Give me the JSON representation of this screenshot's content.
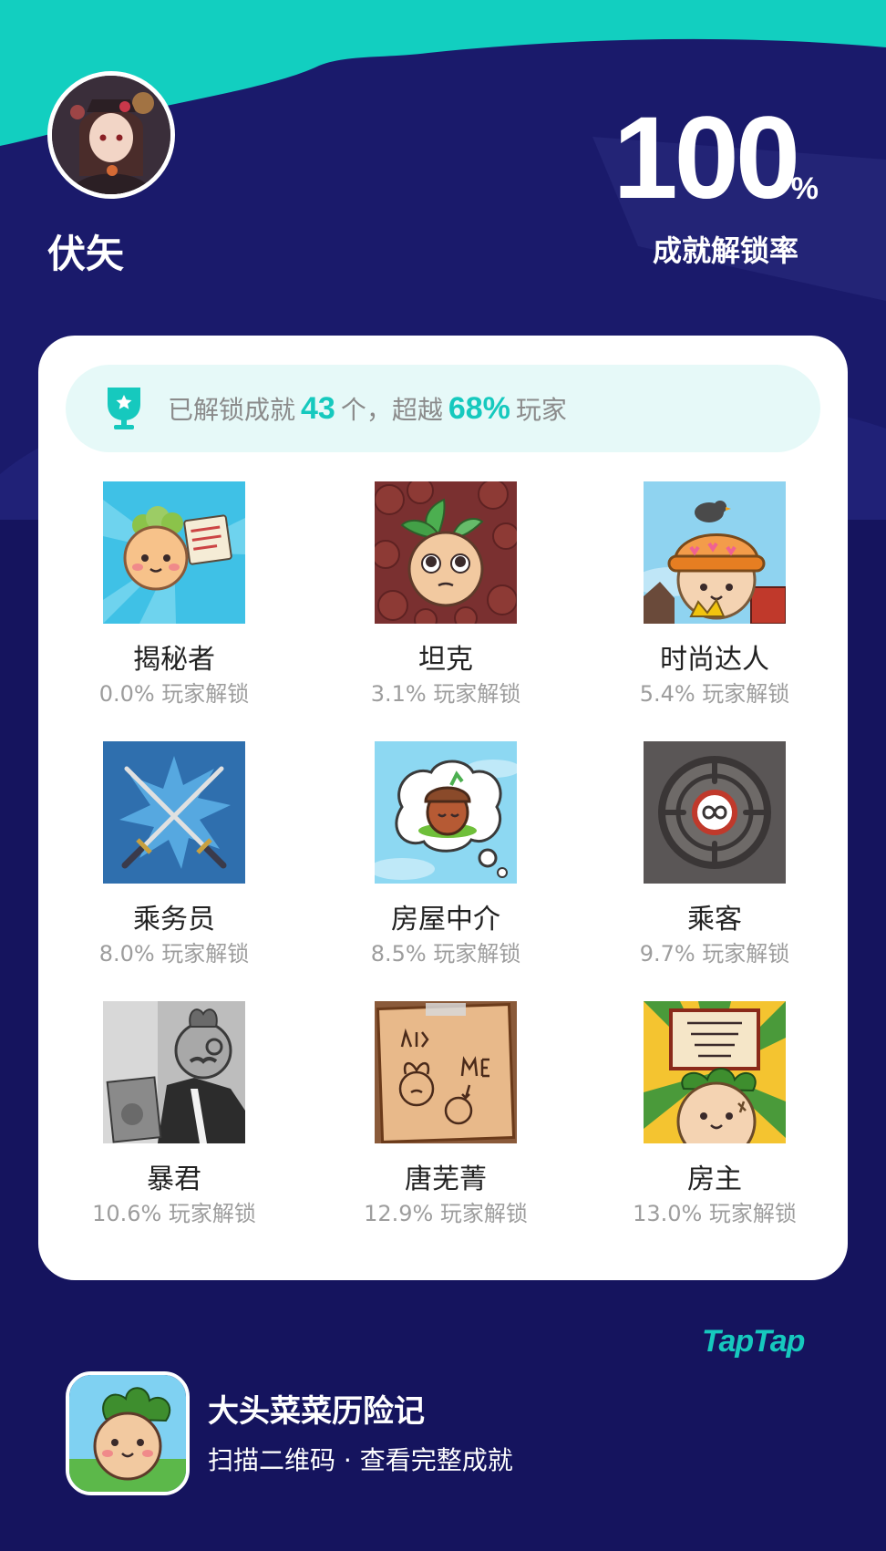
{
  "profile": {
    "username": "伏矢"
  },
  "completion": {
    "rate": "100",
    "percent_sign": "%",
    "label": "成就解锁率"
  },
  "summary": {
    "prefix": "已解锁成就",
    "count": "43",
    "middle": "个，超越",
    "beat_percent": "68%",
    "suffix": "玩家"
  },
  "achievements": [
    {
      "name": "揭秘者",
      "unlock_rate": "0.0% 玩家解锁",
      "icon": "turnip-with-notes-icon"
    },
    {
      "name": "坦克",
      "unlock_rate": "3.1% 玩家解锁",
      "icon": "teary-turnip-icon"
    },
    {
      "name": "时尚达人",
      "unlock_rate": "5.4% 玩家解锁",
      "icon": "turnip-with-hat-icon"
    },
    {
      "name": "乘务员",
      "unlock_rate": "8.0% 玩家解锁",
      "icon": "crossed-swords-icon"
    },
    {
      "name": "房屋中介",
      "unlock_rate": "8.5% 玩家解锁",
      "icon": "acorn-thought-bubble-icon"
    },
    {
      "name": "乘客",
      "unlock_rate": "9.7% 玩家解锁",
      "icon": "infinity-crosshair-icon"
    },
    {
      "name": "暴君",
      "unlock_rate": "10.6% 玩家解锁",
      "icon": "monocle-turnip-icon"
    },
    {
      "name": "唐芜菁",
      "unlock_rate": "12.9% 玩家解锁",
      "icon": "family-drawing-icon"
    },
    {
      "name": "房主",
      "unlock_rate": "13.0% 玩家解锁",
      "icon": "property-deed-turnip-icon"
    }
  ],
  "footer": {
    "brand": "TapTap",
    "game_title": "大头菜菜历险记",
    "subtitle": "扫描二维码 · 查看完整成就"
  },
  "colors": {
    "background": "#15145e",
    "accent": "#16c9be",
    "card": "#ffffff"
  }
}
